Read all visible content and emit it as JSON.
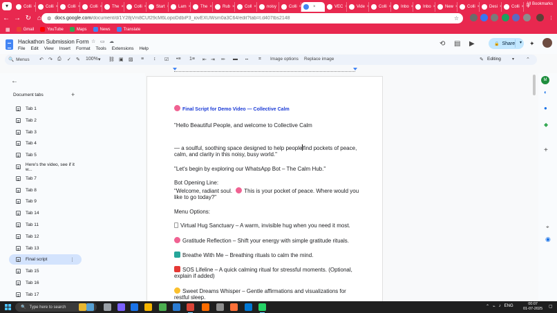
{
  "browser": {
    "tabs": [
      {
        "label": "Colli",
        "active": false,
        "color": "#ffffff"
      },
      {
        "label": "Colli",
        "active": false,
        "color": "#ffffff"
      },
      {
        "label": "Colli",
        "active": false,
        "color": "#ffffff"
      },
      {
        "label": "Colli",
        "active": false,
        "color": "#ffffff"
      },
      {
        "label": "The",
        "active": false,
        "color": "#ffffff"
      },
      {
        "label": "Colli",
        "active": false,
        "color": "#ffffff"
      },
      {
        "label": "Start",
        "active": false,
        "color": "#ffffff"
      },
      {
        "label": "Lam",
        "active": false,
        "color": "#ffffff"
      },
      {
        "label": "The",
        "active": false,
        "color": "#ffffff"
      },
      {
        "label": "Rub",
        "active": false,
        "color": "#ffffff"
      },
      {
        "label": "Coll",
        "active": false,
        "color": "#ffffff"
      },
      {
        "label": "noisy",
        "active": false,
        "color": "#ffffff"
      },
      {
        "label": "Colli",
        "active": false,
        "color": "#ffffff"
      },
      {
        "label": "",
        "active": true,
        "color": "#4285f4"
      },
      {
        "label": "VEC",
        "active": false,
        "color": "#ffffff"
      },
      {
        "label": "Vide",
        "active": false,
        "color": "#ffffff"
      },
      {
        "label": "Colli",
        "active": false,
        "color": "#ffffff"
      },
      {
        "label": "Inbo",
        "active": false,
        "color": "#ffffff"
      },
      {
        "label": "Inbo",
        "active": false,
        "color": "#ffffff"
      },
      {
        "label": "New",
        "active": false,
        "color": "#ffffff"
      },
      {
        "label": "Colli",
        "active": false,
        "color": "#ffffff"
      },
      {
        "label": "Desi",
        "active": false,
        "color": "#ffffff"
      },
      {
        "label": "Colli",
        "active": false,
        "color": "#ffffff"
      }
    ],
    "new_tab": "+",
    "url_host": "docs.google.com",
    "url_path": "/document/d/1Y28jVm8CUf29cM6LopoDdbiP3_iovEXUWsm0a3C64/edit?tab=t.d407tbs2148",
    "bookmarks": [
      {
        "label": "Gmail",
        "color": "#ea4335"
      },
      {
        "label": "YouTube",
        "color": "#ff0000"
      },
      {
        "label": "Maps",
        "color": "#34a853"
      },
      {
        "label": "News",
        "color": "#4285f4"
      },
      {
        "label": "Translate",
        "color": "#4285f4"
      }
    ],
    "all_bookmarks": "All Bookmarks"
  },
  "docs": {
    "title": "Hackathon Submission Form",
    "menu": [
      "File",
      "Edit",
      "View",
      "Insert",
      "Format",
      "Tools",
      "Extensions",
      "Help"
    ],
    "share_label": "Share",
    "toolbar": {
      "menus_label": "Menus",
      "zoom": "100%",
      "image_options": "Image options",
      "replace_image": "Replace image",
      "mode": "Editing"
    }
  },
  "sidebar": {
    "header": "Document tabs",
    "tabs": [
      {
        "label": "Tab 1",
        "active": false
      },
      {
        "label": "Tab 2",
        "active": false
      },
      {
        "label": "Tab 3",
        "active": false
      },
      {
        "label": "Tab 4",
        "active": false
      },
      {
        "label": "Tab 5",
        "active": false
      },
      {
        "label": "Here's the video, see if it w...",
        "active": false
      },
      {
        "label": "Tab 7",
        "active": false
      },
      {
        "label": "Tab 8",
        "active": false
      },
      {
        "label": "Tab 9",
        "active": false
      },
      {
        "label": "Tab 14",
        "active": false
      },
      {
        "label": "Tab 11",
        "active": false
      },
      {
        "label": "Tab 12",
        "active": false
      },
      {
        "label": "Tab 13",
        "active": false
      },
      {
        "label": "Final script",
        "active": true
      },
      {
        "label": "Tab 15",
        "active": false
      },
      {
        "label": "Tab 16",
        "active": false
      },
      {
        "label": "Tab 17",
        "active": false
      }
    ]
  },
  "document": {
    "heading": "Final Script for Demo Video — Collective Calm",
    "lines": [
      "\"Hello Beautiful People, and welcome to Collective Calm",
      "— a soulful, soothing space designed to help people",
      "find pockets of peace,",
      "calm, and clarity in this noisy, busy world.\"",
      "\"Let's begin by exploring our WhatsApp Bot – The Calm Hub.\"",
      "Bot Opening Line:",
      "\"Welcome, radiant soul.",
      "This is your pocket of peace. Where would you",
      "like to go today?\"",
      "Menu Options:",
      "Virtual Hug Sanctuary – A warm, invisible hug when you need it most.",
      "Gratitude Reflection – Shift your energy with simple gratitude rituals.",
      "Breathe With Me – Breathing rituals to calm the mind.",
      "SOS Lifeline – A quick calming ritual for stressful moments. (Optional,",
      "explain if added)",
      "Sweet Dreams Whisper – Gentle affirmations and visualizations for",
      "restful sleep."
    ]
  },
  "taskbar": {
    "search_placeholder": "Type here to search",
    "tray_lang": "ENG",
    "time": "00:07",
    "date": "01-07-2025"
  }
}
